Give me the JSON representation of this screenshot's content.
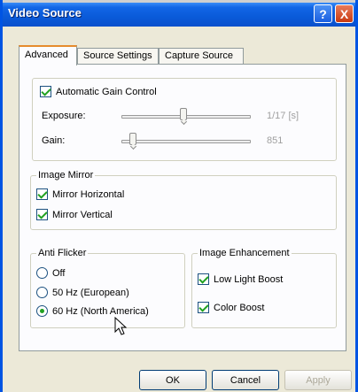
{
  "window": {
    "title": "Video Source"
  },
  "titlebar": {
    "help_label": "?",
    "close_label": "X"
  },
  "tabs": [
    {
      "label": "Advanced"
    },
    {
      "label": "Source Settings"
    },
    {
      "label": "Capture Source"
    }
  ],
  "agc": {
    "label": "Automatic Gain Control",
    "checked": true,
    "exposure": {
      "label": "Exposure:",
      "value": "1/17 [s]",
      "level": 0.48
    },
    "gain": {
      "label": "Gain:",
      "value": "851",
      "level": 0.09
    }
  },
  "image_mirror": {
    "title": "Image Mirror",
    "horizontal": {
      "label": "Mirror Horizontal",
      "checked": true
    },
    "vertical": {
      "label": "Mirror Vertical",
      "checked": true
    }
  },
  "anti_flicker": {
    "title": "Anti Flicker",
    "options": [
      {
        "label": "Off",
        "selected": false
      },
      {
        "label": "50 Hz (European)",
        "selected": false
      },
      {
        "label": "60 Hz (North America)",
        "selected": true
      }
    ]
  },
  "image_enhancement": {
    "title": "Image Enhancement",
    "low_light": {
      "label": "Low Light Boost",
      "checked": true
    },
    "color_boost": {
      "label": "Color Boost",
      "checked": true
    }
  },
  "buttons": {
    "ok": "OK",
    "cancel": "Cancel",
    "apply": "Apply"
  },
  "colors": {
    "titlebar": "#0a5ad9",
    "check": "#21a121",
    "tab_accent": "#e68b2c"
  }
}
